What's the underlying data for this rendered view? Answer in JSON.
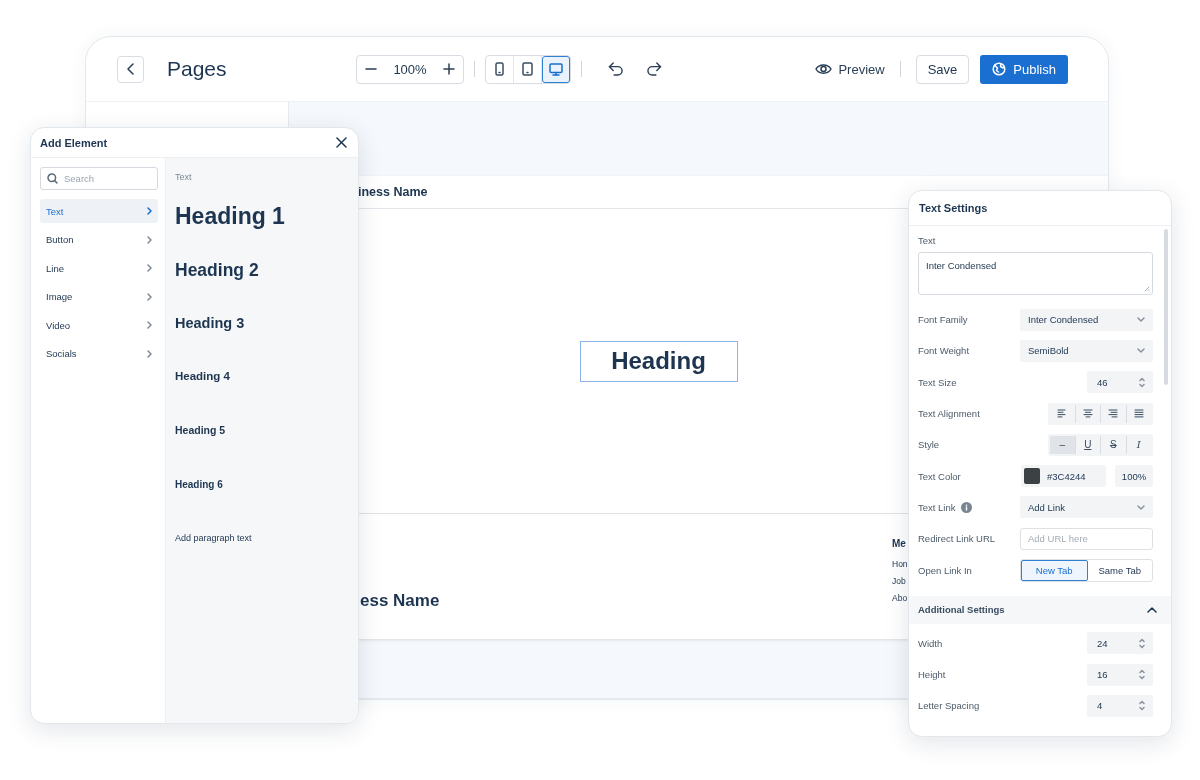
{
  "header": {
    "title": "Pages",
    "zoom": "100%",
    "devices": [
      {
        "kind": "phone",
        "selected": false
      },
      {
        "kind": "tablet",
        "selected": false
      },
      {
        "kind": "desktop",
        "selected": true
      }
    ],
    "preview": "Preview",
    "save": "Save",
    "publish": "Publish"
  },
  "canvas": {
    "header_text": "iness Name",
    "heading": "Heading",
    "footer_title": "ess Name",
    "menu_title": "Me",
    "menu_links": [
      "Hon",
      "Job",
      "Abo"
    ]
  },
  "add_element": {
    "title": "Add Element",
    "search_placeholder": "Search",
    "categories": [
      {
        "label": "Text",
        "selected": true
      },
      {
        "label": "Button",
        "selected": false
      },
      {
        "label": "Line",
        "selected": false
      },
      {
        "label": "Image",
        "selected": false
      },
      {
        "label": "Video",
        "selected": false
      },
      {
        "label": "Socials",
        "selected": false
      }
    ],
    "section_label": "Text",
    "items": [
      {
        "kind": "h1",
        "label": "Heading 1"
      },
      {
        "kind": "h2",
        "label": "Heading 2"
      },
      {
        "kind": "h3",
        "label": "Heading 3"
      },
      {
        "kind": "h4",
        "label": "Heading 4"
      },
      {
        "kind": "h5",
        "label": "Heading 5"
      },
      {
        "kind": "h6",
        "label": "Heading 6"
      },
      {
        "kind": "paragraph",
        "label": "Add paragraph text"
      }
    ]
  },
  "text_settings": {
    "title": "Text Settings",
    "text_label": "Text",
    "text_value": "Inter Condensed",
    "rows": [
      {
        "kind": "select",
        "label": "Font Family",
        "value": "Inter Condensed"
      },
      {
        "kind": "select",
        "label": "Font Weight",
        "value": "SemiBold"
      },
      {
        "kind": "number",
        "label": "Text Size",
        "value": "46"
      },
      {
        "kind": "alignment",
        "label": "Text Alignment",
        "options": [
          {
            "kind": "left",
            "selected": false
          },
          {
            "kind": "center",
            "selected": false
          },
          {
            "kind": "right",
            "selected": false
          },
          {
            "kind": "justify",
            "selected": false
          }
        ]
      },
      {
        "kind": "style",
        "label": "Style",
        "options": [
          {
            "kind": "none",
            "glyph": "–",
            "selected": true
          },
          {
            "kind": "underline",
            "glyph": "U",
            "selected": false
          },
          {
            "kind": "strike",
            "glyph": "S",
            "selected": false
          },
          {
            "kind": "italic",
            "glyph": "I",
            "selected": false
          }
        ]
      },
      {
        "kind": "color",
        "label": "Text Color",
        "value": "#3C4244",
        "opacity": "100%"
      },
      {
        "kind": "select",
        "label": "Text Link",
        "info": true,
        "value": "Add Link"
      },
      {
        "kind": "input",
        "label": "Redirect Link URL",
        "placeholder": "Add URL here"
      },
      {
        "kind": "toggle",
        "label": "Open Link In",
        "options": [
          {
            "label": "New Tab",
            "selected": true
          },
          {
            "label": "Same Tab",
            "selected": false
          }
        ]
      }
    ],
    "additional": {
      "title": "Additional Settings",
      "expanded": true,
      "rows": [
        {
          "label": "Width",
          "value": "24"
        },
        {
          "label": "Height",
          "value": "16"
        },
        {
          "label": "Letter Spacing",
          "value": "4"
        }
      ]
    }
  }
}
